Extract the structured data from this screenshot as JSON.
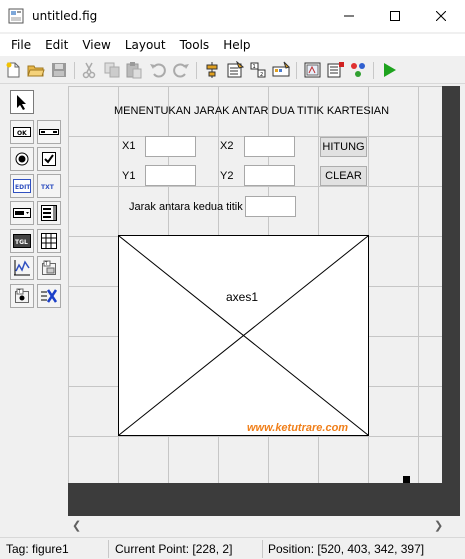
{
  "window": {
    "title": "untitled.fig"
  },
  "menu": [
    "File",
    "Edit",
    "View",
    "Layout",
    "Tools",
    "Help"
  ],
  "toolbar": {
    "icons": [
      "new-file-icon",
      "open-folder-icon",
      "save-icon",
      "cut-icon",
      "copy-icon",
      "paste-icon",
      "undo-icon",
      "redo-icon",
      "align-objects-icon",
      "menu-editor-icon",
      "tab-order-editor-icon",
      "toolbar-editor-icon",
      "mfile-editor-icon",
      "property-inspector-icon",
      "object-browser-icon",
      "run-figure-icon"
    ]
  },
  "palette": {
    "tools": [
      "select-arrow-icon",
      "push-button-icon",
      "slider-icon",
      "radio-button-icon",
      "checkbox-icon",
      "edit-text-icon",
      "static-text-icon",
      "popup-menu-icon",
      "listbox-icon",
      "toggle-button-icon",
      "table-icon",
      "axes-icon",
      "panel-icon",
      "button-group-icon",
      "activex-control-icon"
    ]
  },
  "figure": {
    "title_text": "MENENTUKAN JARAK ANTAR DUA TITIK KARTESIAN",
    "x1_label": "X1",
    "y1_label": "Y1",
    "x2_label": "X2",
    "y2_label": "Y2",
    "hitung_label": "HITUNG",
    "clear_label": "CLEAR",
    "distance_label": "Jarak antara kedua titik",
    "axes_label": "axes1",
    "watermark": "www.ketutrare.com"
  },
  "statusbar": {
    "tag": "Tag: figure1",
    "current_point": "Current Point:  [228, 2]",
    "position": "Position: [520, 403, 342, 397]"
  },
  "colors": {
    "run_green": "#1ea31e",
    "watermark_orange": "#f07f1a",
    "canvas_dark": "#3c3c3c"
  }
}
